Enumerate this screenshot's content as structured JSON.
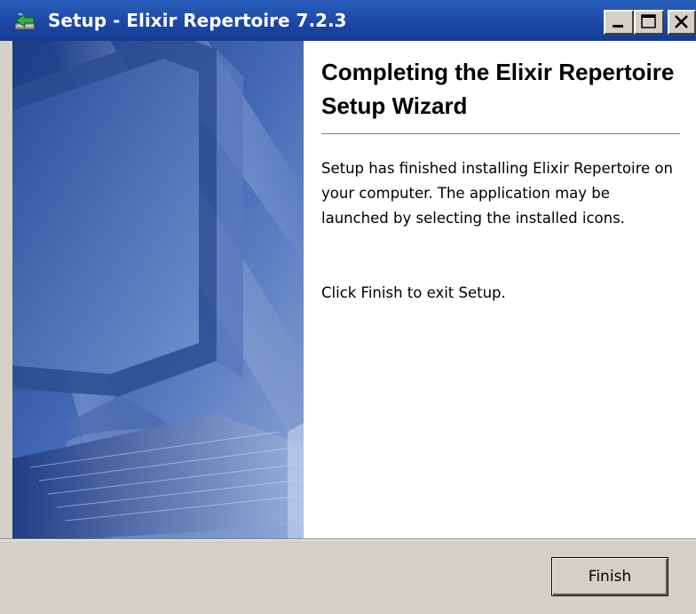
{
  "window": {
    "title": "Setup - Elixir Repertoire 7.2.3",
    "app_icon": "setup-icon",
    "controls": {
      "minimize": "minimize-icon",
      "maximize": "maximize-icon",
      "close": "close-icon"
    }
  },
  "page": {
    "heading": "Completing the Elixir Repertoire Setup Wizard",
    "paragraph1": "Setup has finished installing Elixir Repertoire on your computer. The application may be launched by selecting the installed icons.",
    "paragraph2": "Click Finish to exit Setup."
  },
  "buttons": {
    "finish_label": "Finish"
  },
  "colors": {
    "titlebar": "#1c48a6",
    "face": "#d4d0c8",
    "side_panel_dark": "#1f3f8a",
    "side_panel_light": "#dce6f6"
  }
}
